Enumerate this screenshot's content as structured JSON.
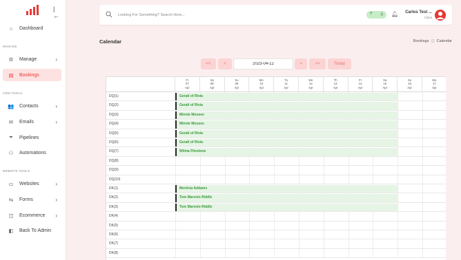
{
  "sidebar": {
    "items": [
      {
        "label": "Dashboard",
        "icon": "home-icon",
        "glyph": "⌂",
        "chevron": ""
      },
      {
        "label": "Manage",
        "icon": "gear-icon",
        "glyph": "⚙",
        "chevron": "›"
      },
      {
        "label": "Bookings",
        "icon": "calendar-icon",
        "glyph": "▤",
        "chevron": ""
      },
      {
        "label": "Contacts",
        "icon": "users-icon",
        "glyph": "👥",
        "chevron": "›"
      },
      {
        "label": "Emails",
        "icon": "mail-icon",
        "glyph": "✉",
        "chevron": "›"
      },
      {
        "label": "Pipelines",
        "icon": "filter-icon",
        "glyph": "⏷",
        "chevron": ""
      },
      {
        "label": "Automations",
        "icon": "robot-icon",
        "glyph": "⚇",
        "chevron": ""
      },
      {
        "label": "Websites",
        "icon": "browser-icon",
        "glyph": "▭",
        "chevron": "›"
      },
      {
        "label": "Forms",
        "icon": "form-icon",
        "glyph": "⇆",
        "chevron": "›"
      },
      {
        "label": "Ecommerce",
        "icon": "bag-icon",
        "glyph": "◫",
        "chevron": "›"
      },
      {
        "label": "Back To Admin",
        "icon": "back-icon",
        "glyph": "◧",
        "chevron": ""
      }
    ],
    "sections": {
      "manage": "MANAGE",
      "crm": "CRM TOOLS",
      "website": "WEBSITE TOOLS"
    }
  },
  "header": {
    "search_placeholder": "Looking For Something? Search Here...",
    "badge_count": "0",
    "user_name": "Carlos Test ...",
    "user_role": "Client"
  },
  "page": {
    "title": "Calendar",
    "breadcrumb": [
      "Bookings",
      "Calendar"
    ]
  },
  "controls": {
    "prev_month": "<<",
    "prev": "<",
    "date": "2023-04-12",
    "next": ">",
    "next_month": ">>",
    "today": "Today"
  },
  "calendar": {
    "days": [
      {
        "dow": "Fr",
        "day": "07",
        "mon": "Apr"
      },
      {
        "dow": "Sa",
        "day": "08",
        "mon": "Apr"
      },
      {
        "dow": "Su",
        "day": "09",
        "mon": "Apr"
      },
      {
        "dow": "Mo",
        "day": "10",
        "mon": "Apr"
      },
      {
        "dow": "Tu",
        "day": "11",
        "mon": "Apr"
      },
      {
        "dow": "We",
        "day": "12",
        "mon": "Apr"
      },
      {
        "dow": "Th",
        "day": "13",
        "mon": "Apr"
      },
      {
        "dow": "Fr",
        "day": "14",
        "mon": "Apr"
      },
      {
        "dow": "Sa",
        "day": "15",
        "mon": "Apr"
      },
      {
        "dow": "Su",
        "day": "16",
        "mon": "Apr"
      },
      {
        "dow": "Mo",
        "day": "17",
        "mon": "Apr"
      }
    ],
    "rows": [
      {
        "label": "DQ(1)",
        "booking": "Geralt of Rivia"
      },
      {
        "label": "DQ(2)",
        "booking": "Geralt of Rivia"
      },
      {
        "label": "DQ(3)",
        "booking": "Minnie Mouses"
      },
      {
        "label": "DQ(4)",
        "booking": "Minnie Mouses"
      },
      {
        "label": "DQ(5)",
        "booking": "Geralt of Rivia"
      },
      {
        "label": "DQ(6)",
        "booking": "Geralt of Rivia"
      },
      {
        "label": "DQ(7)",
        "booking": "Wilma Flinstone"
      },
      {
        "label": "DQ(8)",
        "booking": ""
      },
      {
        "label": "DQ(9)",
        "booking": ""
      },
      {
        "label": "DQ(10)",
        "booking": ""
      },
      {
        "label": "DK(1)",
        "booking": "Morticia Addams"
      },
      {
        "label": "DK(2)",
        "booking": "Tom Marvolo Riddle"
      },
      {
        "label": "DK(3)",
        "booking": "Tom Marvolo Riddle"
      },
      {
        "label": "DK(4)",
        "booking": ""
      },
      {
        "label": "DK(5)",
        "booking": ""
      },
      {
        "label": "DK(6)",
        "booking": ""
      },
      {
        "label": "DK(7)",
        "booking": ""
      },
      {
        "label": "DK(8)",
        "booking": ""
      }
    ]
  },
  "colors": {
    "accent": "#e53935",
    "booking_bg": "#e6f4e6",
    "booking_text": "#3a9a3a",
    "button_bg": "#fcd4d4"
  }
}
